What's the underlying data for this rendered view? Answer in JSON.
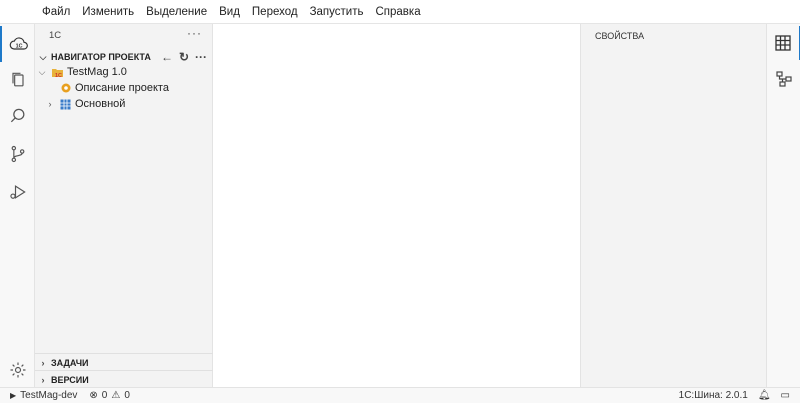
{
  "menu": [
    "Файл",
    "Изменить",
    "Выделение",
    "Вид",
    "Переход",
    "Запустить",
    "Справка"
  ],
  "activity_bar": [
    {
      "name": "1c-cloud-icon",
      "active": true
    },
    {
      "name": "explorer-icon",
      "active": false
    },
    {
      "name": "search-icon",
      "active": false
    },
    {
      "name": "source-control-icon",
      "active": false
    },
    {
      "name": "run-debug-icon",
      "active": false
    },
    {
      "name": "settings-gear-icon",
      "active": false
    }
  ],
  "sidebar": {
    "title": "1С",
    "more": "···",
    "navigator": {
      "header": "НАВИГАТОР ПРОЕКТА",
      "tree": [
        {
          "label": "TestMag 1.0",
          "icon": "1c-project-icon",
          "expanded": true
        },
        {
          "label": "Описание проекта",
          "icon": "gear-icon"
        },
        {
          "label": "Основной",
          "icon": "grid-icon",
          "expanded": false
        }
      ]
    },
    "tasks_header": "ЗАДАЧИ",
    "versions_header": "ВЕРСИИ"
  },
  "properties": {
    "title": "СВОЙСТВА"
  },
  "right_bar": [
    {
      "name": "table-icon",
      "active": true
    },
    {
      "name": "structure-icon",
      "active": false
    }
  ],
  "status": {
    "project": "TestMag-dev",
    "errors": "0",
    "warnings": "0",
    "version": "1С:Шина: 2.0.1"
  },
  "colors": {
    "accent": "#1e79c9",
    "sidebar_bg": "#f3f3f3"
  }
}
